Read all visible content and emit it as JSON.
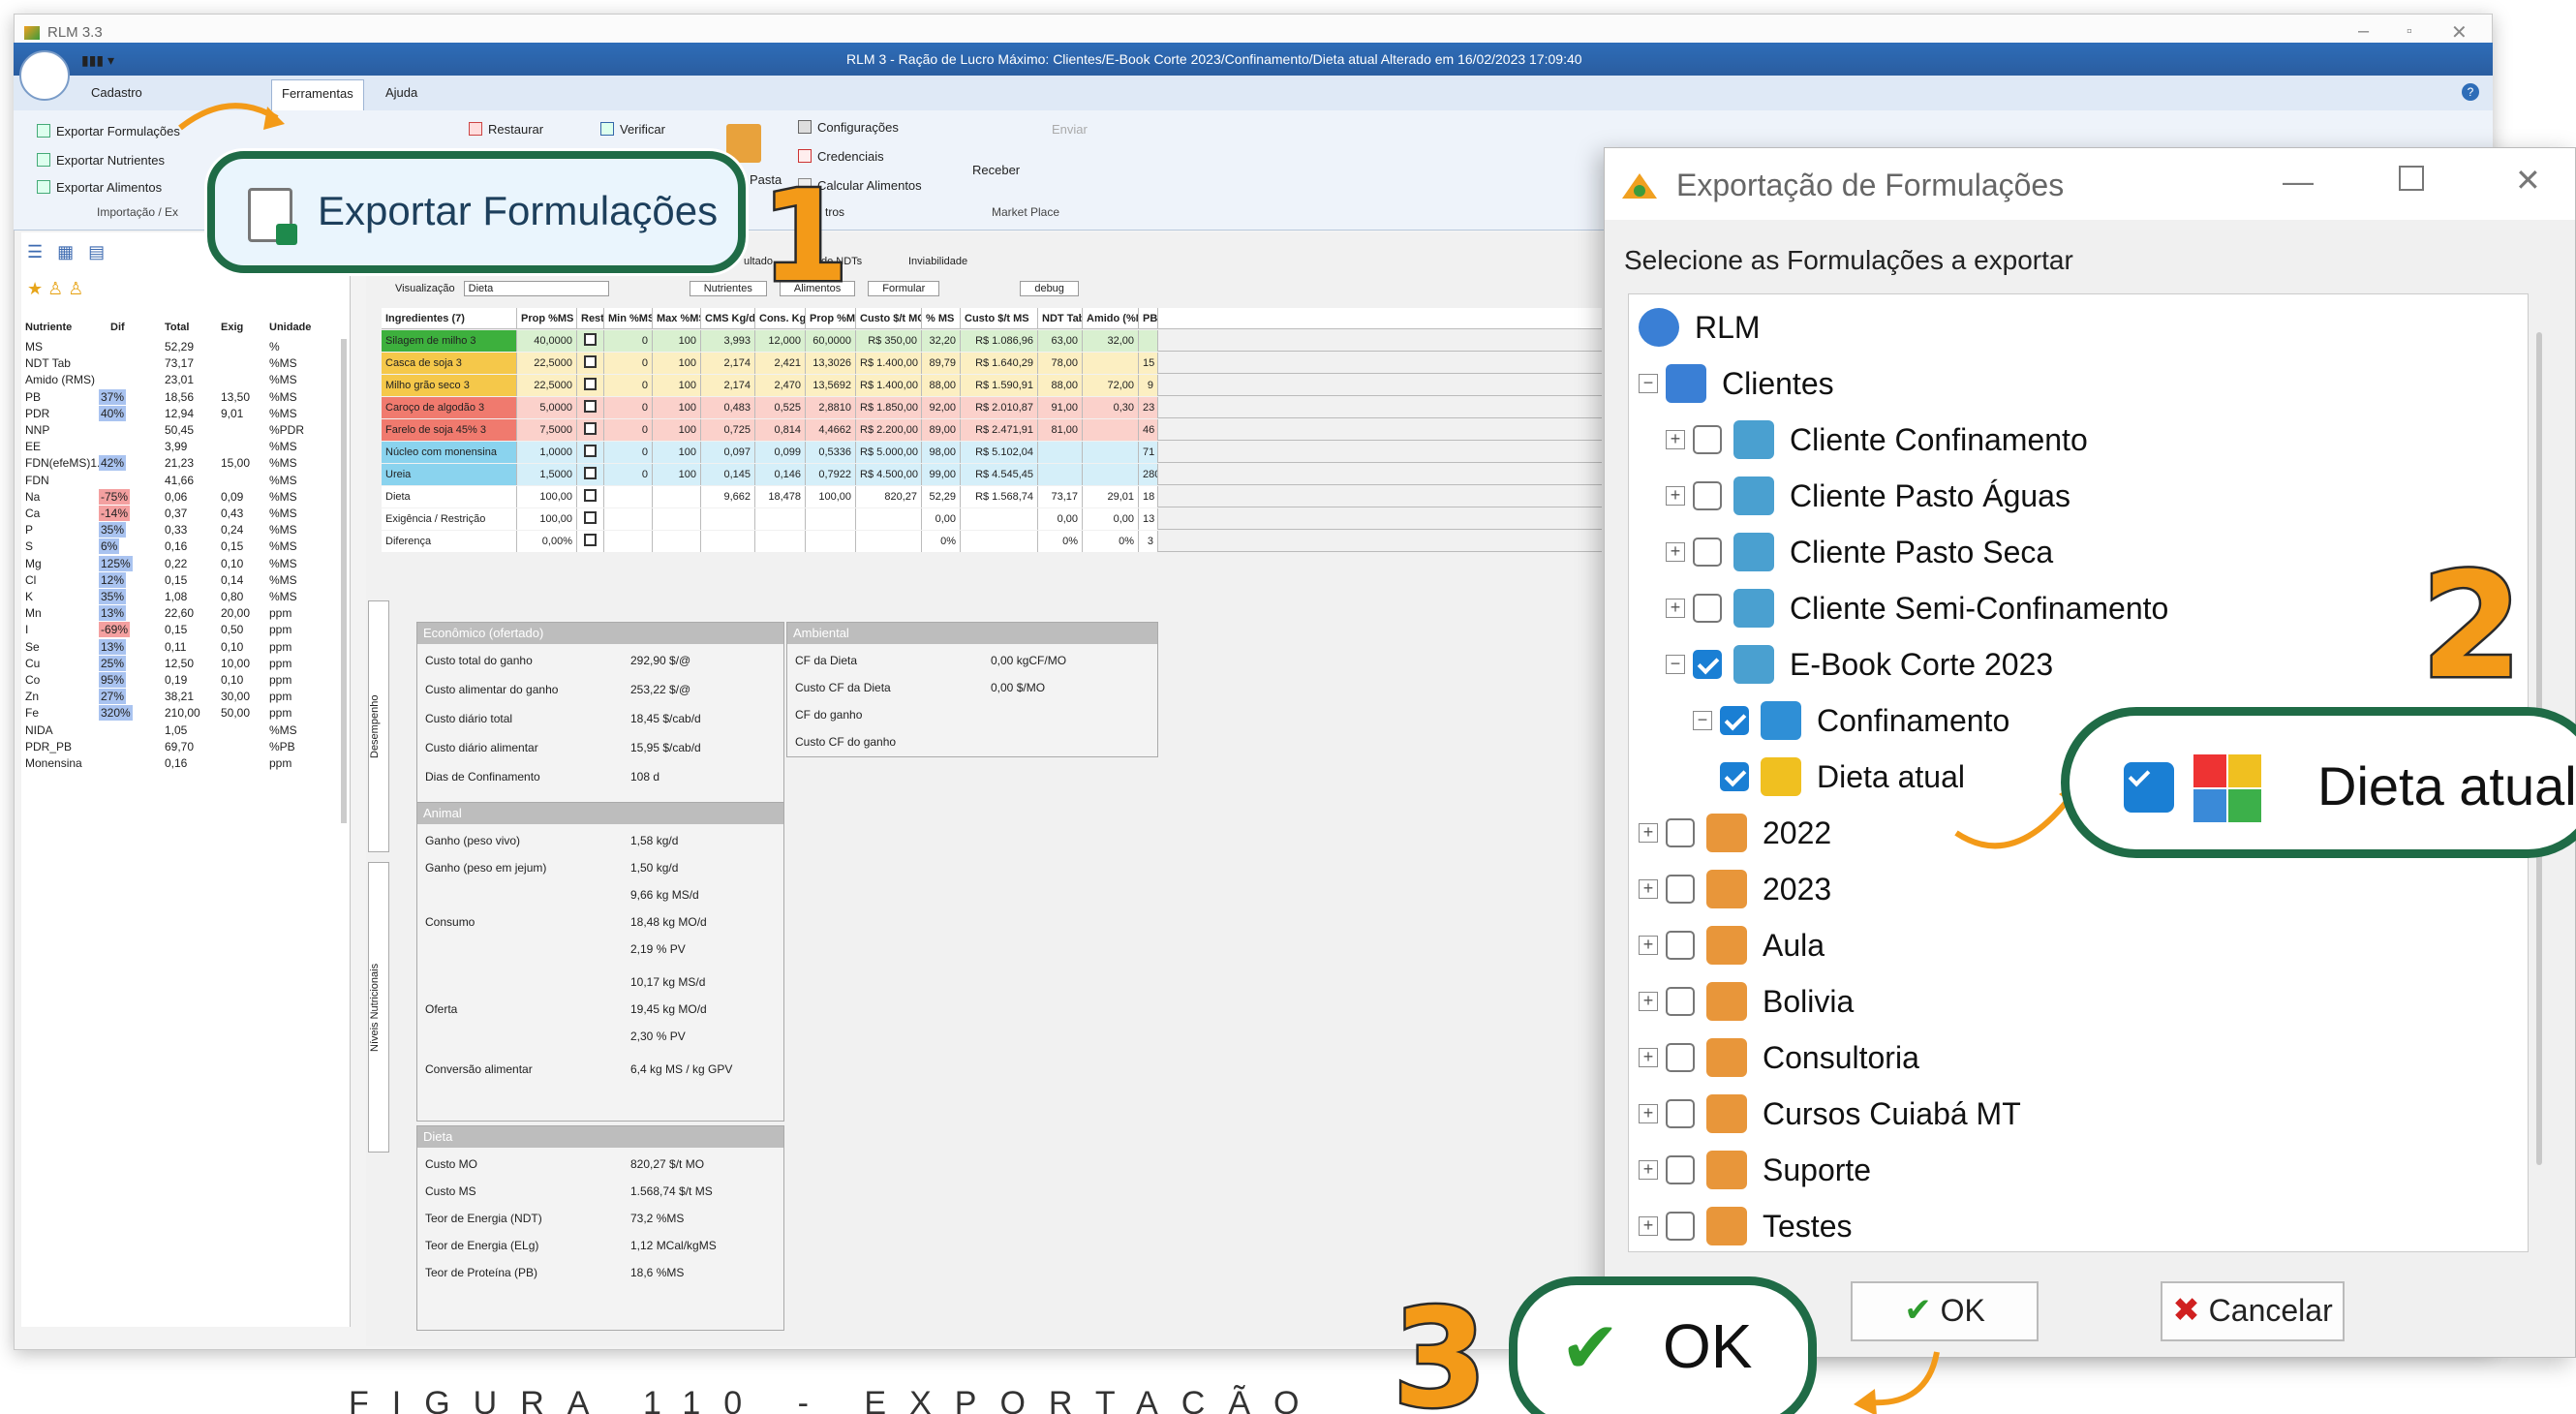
{
  "app": {
    "window_title": "RLM 3.3",
    "banner": "RLM 3 - Ração de Lucro Máximo: Clientes/E-Book Corte 2023/Confinamento/Dieta atual Alterado em 16/02/2023 17:09:40"
  },
  "menu": {
    "items": [
      "Cadastro",
      "Ferramentas",
      "Ajuda"
    ],
    "selected": "Ferramentas"
  },
  "ribbon": {
    "import_export": [
      "Exportar Formulações",
      "Exportar Nutrientes",
      "Exportar Alimentos"
    ],
    "group_label": "Importação / Ex",
    "restore": "Restaurar",
    "verify": "Verificar",
    "config": [
      "Configurações",
      "Credenciais",
      "Calcular Alimentos"
    ],
    "paste": "Pasta",
    "receive": "Receber",
    "send": "Enviar",
    "market": "Market Place",
    "tros": "tros"
  },
  "callout1": {
    "label": "Exportar Formulações",
    "step": "1"
  },
  "left_nutrients": {
    "headers": [
      "Nutriente",
      "Dif",
      "Total",
      "Exig",
      "Unidade"
    ],
    "rows": [
      [
        "MS",
        "",
        "52,29",
        "",
        "%"
      ],
      [
        "NDT Tab",
        "",
        "73,17",
        "",
        "%MS"
      ],
      [
        "Amido (RMS)",
        "",
        "23,01",
        "",
        "%MS"
      ],
      [
        "PB",
        "37%",
        "18,56",
        "13,50",
        "%MS"
      ],
      [
        "PDR",
        "40%",
        "12,94",
        "9,01",
        "%MS"
      ],
      [
        "NNP",
        "",
        "50,45",
        "",
        "%PDR"
      ],
      [
        "EE",
        "",
        "3,99",
        "",
        "%MS"
      ],
      [
        "FDN(efeMS)1.",
        "42%",
        "21,23",
        "15,00",
        "%MS"
      ],
      [
        "FDN",
        "",
        "41,66",
        "",
        "%MS"
      ],
      [
        "Na",
        "-75%",
        "0,06",
        "0,09",
        "%MS"
      ],
      [
        "Ca",
        "-14%",
        "0,37",
        "0,43",
        "%MS"
      ],
      [
        "P",
        "35%",
        "0,33",
        "0,24",
        "%MS"
      ],
      [
        "S",
        "6%",
        "0,16",
        "0,15",
        "%MS"
      ],
      [
        "Mg",
        "125%",
        "0,22",
        "0,10",
        "%MS"
      ],
      [
        "Cl",
        "12%",
        "0,15",
        "0,14",
        "%MS"
      ],
      [
        "K",
        "35%",
        "1,08",
        "0,80",
        "%MS"
      ],
      [
        "Mn",
        "13%",
        "22,60",
        "20,00",
        "ppm"
      ],
      [
        "I",
        "-69%",
        "0,15",
        "0,50",
        "ppm"
      ],
      [
        "Se",
        "13%",
        "0,11",
        "0,10",
        "ppm"
      ],
      [
        "Cu",
        "25%",
        "12,50",
        "10,00",
        "ppm"
      ],
      [
        "Co",
        "95%",
        "0,19",
        "0,10",
        "ppm"
      ],
      [
        "Zn",
        "27%",
        "38,21",
        "30,00",
        "ppm"
      ],
      [
        "Fe",
        "320%",
        "210,00",
        "50,00",
        "ppm"
      ],
      [
        "NIDA",
        "",
        "1,05",
        "",
        "%MS"
      ],
      [
        "PDR_PB",
        "",
        "69,70",
        "",
        "%PB"
      ],
      [
        "Monensina",
        "",
        "0,16",
        "",
        "ppm"
      ]
    ]
  },
  "view_bar": {
    "label": "Visualização",
    "value": "Dieta",
    "tabs": [
      "Nutrientes",
      "Alimentos",
      "Formular",
      "debug"
    ],
    "extra": [
      "de NDTs",
      "Inviabilidade"
    ],
    "resultado": "ultado"
  },
  "grid": {
    "headers": [
      "Ingredientes (7)",
      "Prop %MS",
      "Restr",
      "Min %MS",
      "Max %MS",
      "CMS Kg/d",
      "Cons. Kg/d",
      "Prop %MO",
      "Custo $/t MO",
      "% MS",
      "Custo $/t MS",
      "NDT Tab",
      "Amido (%MS)",
      "PB"
    ],
    "rows": [
      {
        "c": [
          "Silagem de milho 3",
          "40,0000",
          "",
          "0",
          "100",
          "3,993",
          "12,000",
          "60,0000",
          "R$ 350,00",
          "32,20",
          "R$ 1.086,96",
          "63,00",
          "32,00",
          ""
        ],
        "bg": "#3db03d"
      },
      {
        "c": [
          "Casca de soja 3",
          "22,5000",
          "",
          "0",
          "100",
          "2,174",
          "2,421",
          "13,3026",
          "R$ 1.400,00",
          "89,79",
          "R$ 1.640,29",
          "78,00",
          "",
          "15"
        ],
        "bg": "#f5c84a"
      },
      {
        "c": [
          "Milho grão seco 3",
          "22,5000",
          "",
          "0",
          "100",
          "2,174",
          "2,470",
          "13,5692",
          "R$ 1.400,00",
          "88,00",
          "R$ 1.590,91",
          "88,00",
          "72,00",
          "9"
        ],
        "bg": "#f5c84a"
      },
      {
        "c": [
          "Caroço de algodão 3",
          "5,0000",
          "",
          "0",
          "100",
          "0,483",
          "0,525",
          "2,8810",
          "R$ 1.850,00",
          "92,00",
          "R$ 2.010,87",
          "91,00",
          "0,30",
          "23"
        ],
        "bg": "#f07a6e"
      },
      {
        "c": [
          "Farelo de soja 45% 3",
          "7,5000",
          "",
          "0",
          "100",
          "0,725",
          "0,814",
          "4,4662",
          "R$ 2.200,00",
          "89,00",
          "R$ 2.471,91",
          "81,00",
          "",
          "46"
        ],
        "bg": "#f07a6e"
      },
      {
        "c": [
          "Núcleo com monensina",
          "1,0000",
          "",
          "0",
          "100",
          "0,097",
          "0,099",
          "0,5336",
          "R$ 5.000,00",
          "98,00",
          "R$ 5.102,04",
          "",
          "",
          "71"
        ],
        "bg": "#8ad3ee"
      },
      {
        "c": [
          "Ureia",
          "1,5000",
          "",
          "0",
          "100",
          "0,145",
          "0,146",
          "0,7922",
          "R$ 4.500,00",
          "99,00",
          "R$ 4.545,45",
          "",
          "",
          "280"
        ],
        "bg": "#8ad3ee"
      },
      {
        "c": [
          "Dieta",
          "100,00",
          "",
          "",
          "",
          "9,662",
          "18,478",
          "100,00",
          "820,27",
          "52,29",
          "R$ 1.568,74",
          "73,17",
          "29,01",
          "18"
        ],
        "bg": "#fff"
      },
      {
        "c": [
          "Exigência / Restrição",
          "100,00",
          "",
          "",
          "",
          "",
          "",
          "",
          "",
          "0,00",
          "",
          "0,00",
          "0,00",
          "13"
        ],
        "bg": "#fff"
      },
      {
        "c": [
          "Diferença",
          "0,00%",
          "",
          "",
          "",
          "",
          "",
          "",
          "",
          "0%",
          "",
          "0%",
          "0%",
          "3"
        ],
        "bg": "#fff"
      }
    ]
  },
  "side_tabs": [
    "Desempenho",
    "Níveis Nutricionais"
  ],
  "economic": {
    "title": "Econômico (ofertado)",
    "rows": [
      [
        "Custo total do ganho",
        "292,90 $/@"
      ],
      [
        "Custo alimentar do ganho",
        "253,22 $/@"
      ],
      [
        "Custo diário total",
        "18,45 $/cab/d"
      ],
      [
        "Custo diário alimentar",
        "15,95 $/cab/d"
      ],
      [
        "Dias de Confinamento",
        "108 d"
      ]
    ]
  },
  "environmental": {
    "title": "Ambiental",
    "rows": [
      [
        "CF da Dieta",
        "0,00 kgCF/MO"
      ],
      [
        "Custo CF da Dieta",
        "0,00 $/MO"
      ],
      [
        "CF do ganho",
        ""
      ],
      [
        "Custo CF do ganho",
        ""
      ]
    ]
  },
  "animal": {
    "title": "Animal",
    "rows": [
      [
        "Ganho (peso vivo)",
        "1,58 kg/d"
      ],
      [
        "Ganho (peso em jejum)",
        "1,50 kg/d"
      ],
      [
        "Consumo",
        "9,66 kg MS/d",
        "18,48 kg MO/d",
        "2,19 % PV"
      ],
      [
        "Oferta",
        "10,17 kg MS/d",
        "19,45 kg MO/d",
        "2,30 % PV"
      ],
      [
        "Conversão alimentar",
        "6,4 kg MS / kg GPV"
      ]
    ]
  },
  "diet": {
    "title": "Dieta",
    "rows": [
      [
        "Custo MO",
        "820,27 $/t MO"
      ],
      [
        "Custo MS",
        "1.568,74 $/t MS"
      ],
      [
        "Teor de Energia (NDT)",
        "73,2 %MS"
      ],
      [
        "Teor de Energia (ELg)",
        "1,12 MCal/kgMS"
      ],
      [
        "Teor de Proteína (PB)",
        "18,6 %MS"
      ]
    ]
  },
  "dialog": {
    "title": "Exportação de Formulações",
    "prompt": "Selecione as Formulações a exportar",
    "tree": {
      "root": "RLM",
      "clients": "Clientes",
      "client_items": [
        "Cliente Confinamento",
        "Cliente Pasto Águas",
        "Cliente Pasto Seca",
        "Cliente Semi-Confinamento",
        "E-Book Corte 2023"
      ],
      "sub": "Confinamento",
      "leaf": "Dieta atual",
      "groups": [
        "2022",
        "2023",
        "Aula",
        "Bolivia",
        "Consultoria",
        "Cursos Cuiabá MT",
        "Suporte",
        "Testes"
      ]
    },
    "ok": "OK",
    "cancel": "Cancelar"
  },
  "callout2": {
    "label": "Dieta atual",
    "step": "2"
  },
  "callout3": {
    "label": "OK",
    "step": "3"
  },
  "caption": "FIGURA 110 - EXPORTAÇÃO",
  "colors": {
    "accent": "#1f6b46",
    "step": "#f39a18",
    "check": "#1a7fd4",
    "banner": "#2e6db8"
  }
}
